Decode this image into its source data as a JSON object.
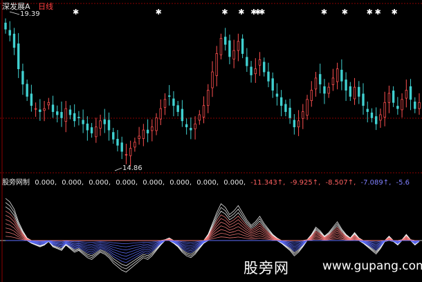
{
  "header": {
    "stock": "深发展A",
    "period": "日线"
  },
  "price_labels": {
    "high": "19.39",
    "low": "14.86"
  },
  "indicator": {
    "name": "股旁网制",
    "values": [
      "0.000,",
      "0.000,",
      "0.000,",
      "0.000,",
      "0.000,",
      "0.000,",
      "0.000,",
      "0.000,",
      "-11.343↑,",
      "-9.925↑,",
      "-8.507↑,",
      "-7.089↑,",
      "-5.6"
    ]
  },
  "watermark": {
    "text": "股旁网",
    "url": "www.gupang.com"
  },
  "colors": {
    "up": "#ff5050",
    "down": "#40d0d0",
    "ind_pos": "#ff8080",
    "ind_neg": "#6070ff",
    "grid": "#8b0000"
  },
  "price_range": [
    14.5,
    19.7
  ],
  "candles_close": [
    19.2,
    19.0,
    18.6,
    17.9,
    17.4,
    17.0,
    16.7,
    16.6,
    16.5,
    16.6,
    16.8,
    16.5,
    16.4,
    16.3,
    16.6,
    16.4,
    16.2,
    16.3,
    16.1,
    15.9,
    15.8,
    16.0,
    16.2,
    16.1,
    15.9,
    15.6,
    15.4,
    15.2,
    15.1,
    15.3,
    15.5,
    15.7,
    15.9,
    15.8,
    16.0,
    16.3,
    16.6,
    16.9,
    17.0,
    16.7,
    16.5,
    16.2,
    16.0,
    15.9,
    16.1,
    16.4,
    16.7,
    17.2,
    17.8,
    18.4,
    18.9,
    18.7,
    18.3,
    18.5,
    18.8,
    18.4,
    18.0,
    17.7,
    17.9,
    18.2,
    17.8,
    17.5,
    17.2,
    17.0,
    16.7,
    16.5,
    16.3,
    16.0,
    16.2,
    16.5,
    16.9,
    17.2,
    17.6,
    17.4,
    17.1,
    17.3,
    17.6,
    17.9,
    17.5,
    17.2,
    17.0,
    17.3,
    17.0,
    16.7,
    16.5,
    16.3,
    16.1,
    16.4,
    16.8,
    17.1,
    16.8,
    16.6,
    16.9,
    17.2,
    16.9,
    16.6,
    16.8
  ],
  "markers": [
    0.17,
    0.37,
    0.53,
    0.57,
    0.6,
    0.61,
    0.62,
    0.77,
    0.82,
    0.88,
    0.9,
    0.94
  ]
}
